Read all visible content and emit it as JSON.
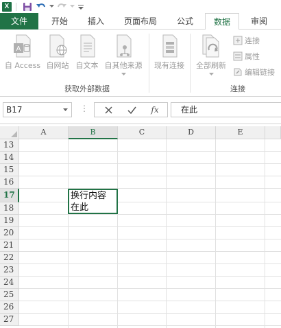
{
  "titlebar": {
    "app_icon_label": "X",
    "icons": [
      "excel-icon",
      "save-icon",
      "undo-icon",
      "redo-icon",
      "customize-quick-access-icon"
    ]
  },
  "tabs": {
    "file": "文件",
    "home": "开始",
    "insert": "插入",
    "page_layout": "页面布局",
    "formulas": "公式",
    "data": "数据",
    "review": "审阅"
  },
  "ribbon": {
    "get_external": {
      "access": "自 Access",
      "web": "自网站",
      "text": "自文本",
      "other": "自其他来源",
      "label": "获取外部数据"
    },
    "existing": "现有连接",
    "refresh_all": "全部刷新",
    "connections": {
      "connections": "连接",
      "properties": "属性",
      "edit_links": "编辑链接",
      "label": "连接"
    }
  },
  "formula_bar": {
    "name_box": "B17",
    "fx": "fx",
    "content": "在此"
  },
  "grid": {
    "columns": [
      "A",
      "B",
      "C",
      "D",
      "E"
    ],
    "selected_column": "B",
    "rows": [
      "13",
      "14",
      "15",
      "16",
      "17",
      "18",
      "19",
      "20",
      "21",
      "22",
      "23",
      "24",
      "25",
      "26",
      "27"
    ],
    "selected_row": "17",
    "active_cell_text": "换行内容\n在此"
  },
  "colors": {
    "accent": "#217346",
    "ribbon_icon": "#a9a9a9",
    "grid_line": "#e1e1e1",
    "header_bg": "#f0f0f0"
  }
}
